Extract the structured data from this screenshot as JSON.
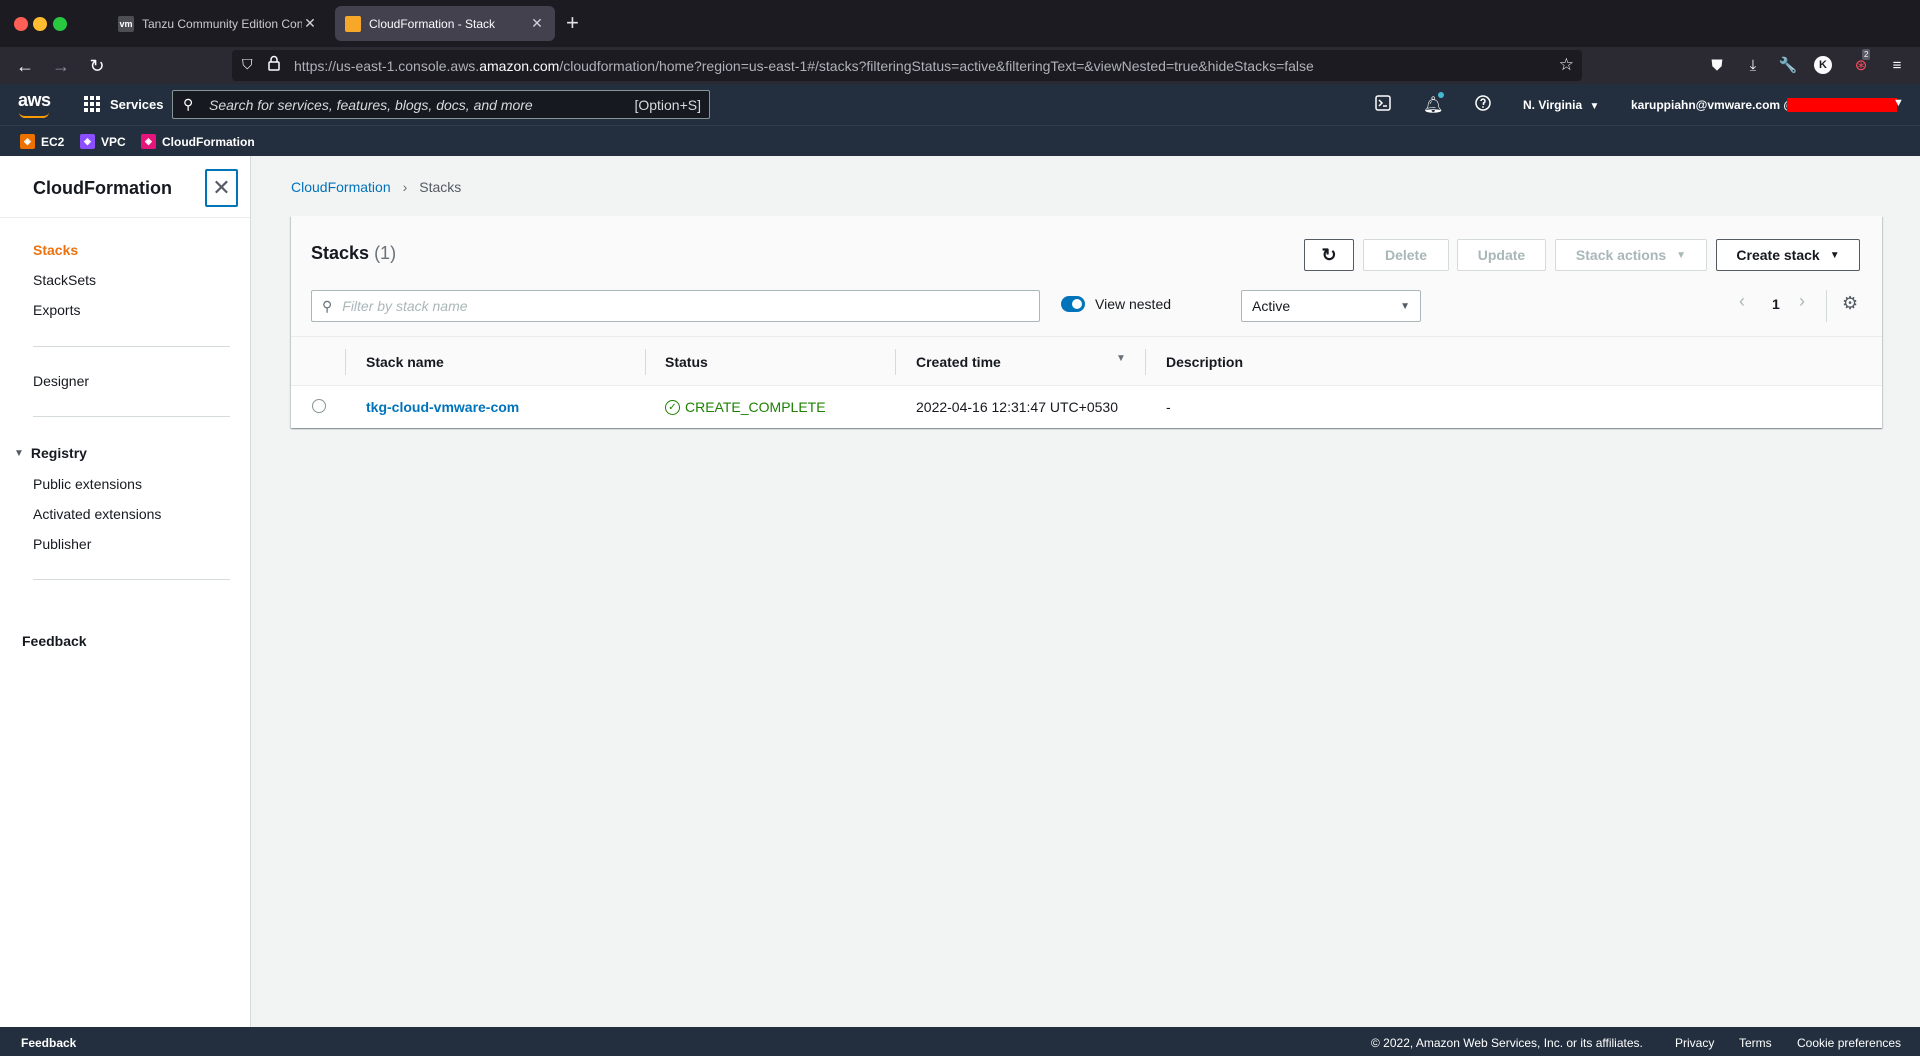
{
  "browser": {
    "tabs": [
      {
        "title": "Tanzu Community Edition Confi",
        "icon_text": "vm"
      },
      {
        "title": "CloudFormation - Stack",
        "icon_text": ""
      }
    ],
    "url_prefix": "https://us-east-1.console.aws.",
    "url_domain": "amazon.com",
    "url_suffix": "/cloudformation/home?region=us-east-1#/stacks?filteringStatus=active&filteringText=&viewNested=true&hideStacks=false",
    "extension_badge": "2",
    "profile_initial": "K"
  },
  "aws_header": {
    "logo": "aws",
    "services_label": "Services",
    "search_placeholder": "Search for services, features, blogs, docs, and more",
    "search_shortcut": "[Option+S]",
    "region": "N. Virginia",
    "account": "karuppiahn@vmware.com @",
    "favorites": [
      {
        "label": "EC2",
        "color": "#ed7100"
      },
      {
        "label": "VPC",
        "color": "#8c4fff"
      },
      {
        "label": "CloudFormation",
        "color": "#e7157b"
      }
    ]
  },
  "sidebar": {
    "title": "CloudFormation",
    "items": [
      "Stacks",
      "StackSets",
      "Exports"
    ],
    "designer": "Designer",
    "registry_section": "Registry",
    "registry_items": [
      "Public extensions",
      "Activated extensions",
      "Publisher"
    ],
    "feedback": "Feedback"
  },
  "breadcrumb": {
    "root": "CloudFormation",
    "current": "Stacks"
  },
  "stacks_panel": {
    "title": "Stacks",
    "count": "(1)",
    "buttons": {
      "delete": "Delete",
      "update": "Update",
      "stack_actions": "Stack actions",
      "create_stack": "Create stack"
    },
    "filter_placeholder": "Filter by stack name",
    "view_nested_label": "View nested",
    "status_filter": "Active",
    "page": "1",
    "columns": [
      "Stack name",
      "Status",
      "Created time",
      "Description"
    ],
    "rows": [
      {
        "name": "tkg-cloud-vmware-com",
        "status": "CREATE_COMPLETE",
        "created": "2022-04-16 12:31:47 UTC+0530",
        "description": "-"
      }
    ]
  },
  "footer": {
    "feedback": "Feedback",
    "copyright": "© 2022, Amazon Web Services, Inc. or its affiliates.",
    "privacy": "Privacy",
    "terms": "Terms",
    "cookies": "Cookie preferences"
  },
  "colors": {
    "aws_navy": "#232f3e",
    "link_blue": "#0073bb",
    "active_orange": "#ec7211",
    "success_green": "#1d8102"
  }
}
